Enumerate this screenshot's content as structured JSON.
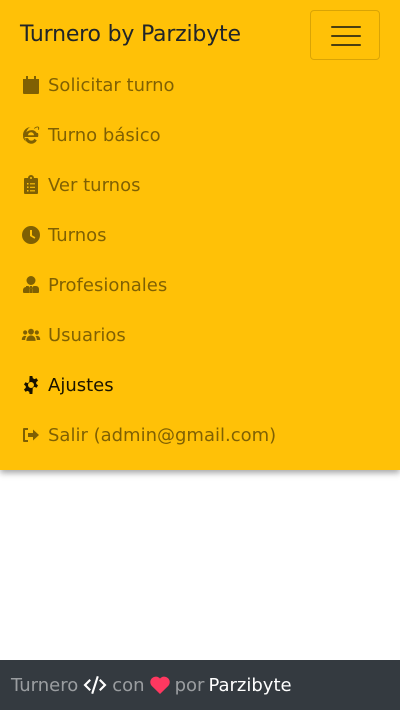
{
  "navbar": {
    "brand": "Turnero by Parzibyte",
    "toggler_icon": "hamburger-icon",
    "background": "#ffc107"
  },
  "menu": {
    "items": [
      {
        "label": "Solicitar turno",
        "icon": "calendar-plus-icon"
      },
      {
        "label": "Turno básico",
        "icon": "internet-explorer-icon"
      },
      {
        "label": "Ver turnos",
        "icon": "clipboard-list-icon"
      },
      {
        "label": "Turnos",
        "icon": "clock-icon"
      },
      {
        "label": "Profesionales",
        "icon": "user-tie-icon"
      },
      {
        "label": "Usuarios",
        "icon": "users-icon"
      },
      {
        "label": "Ajustes",
        "icon": "cog-icon",
        "active": true
      },
      {
        "label": "Salir (admin@gmail.com)",
        "icon": "sign-out-icon"
      }
    ]
  },
  "footer": {
    "text_start": "Turnero",
    "text_mid": "con",
    "text_por": "por",
    "author": "Parzibyte",
    "background": "#343a40",
    "heart_color": "#ff3860"
  }
}
